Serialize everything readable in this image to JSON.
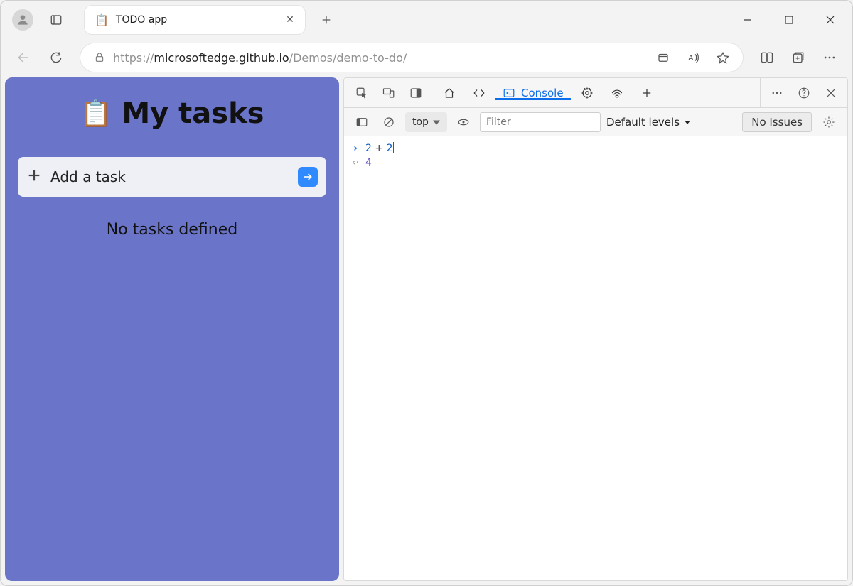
{
  "browser": {
    "tab_title": "TODO app",
    "url_gray_prefix": "https://",
    "url_host": "microsoftedge.github.io",
    "url_path": "/Demos/demo-to-do/"
  },
  "page": {
    "heading": "My tasks",
    "add_placeholder": "Add a task",
    "empty_message": "No tasks defined"
  },
  "devtools": {
    "active_tab": "Console",
    "context": "top",
    "filter_placeholder": "Filter",
    "levels_label": "Default levels",
    "issues_label": "No Issues",
    "input_expr_tokens": [
      "2",
      " + ",
      "2"
    ],
    "result": "4"
  }
}
